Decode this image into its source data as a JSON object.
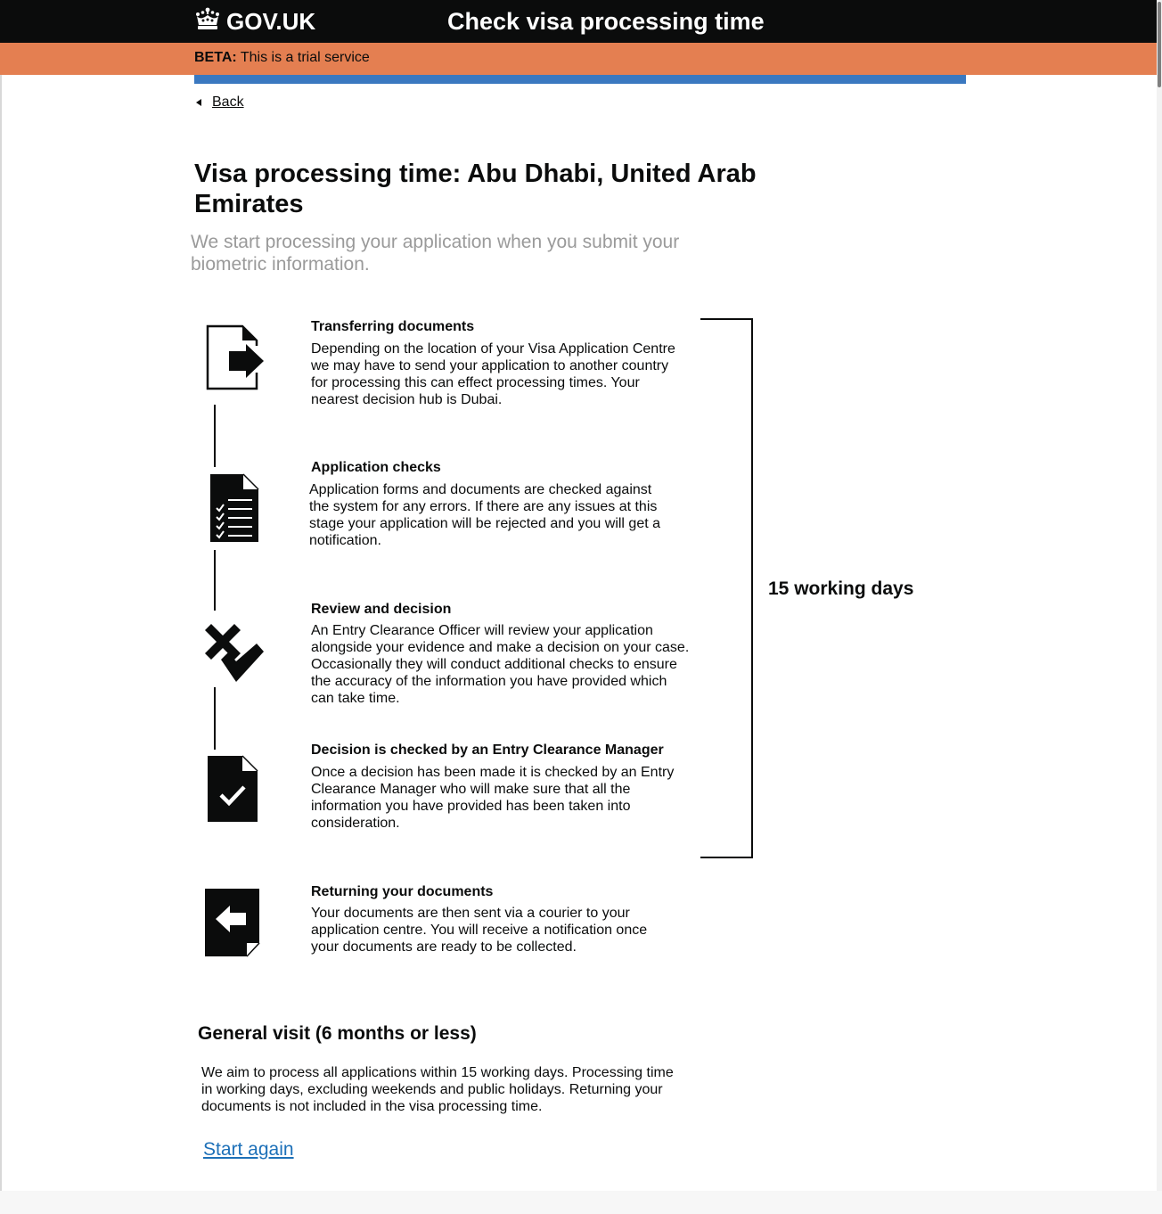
{
  "header": {
    "logo_text": "GOV.UK",
    "service_name": "Check visa processing time",
    "logo_icon": "crown-icon",
    "background": "#0b0c0c"
  },
  "beta": {
    "tag": "BETA:",
    "text": "This is a trial service",
    "color": "#e47f51"
  },
  "accent_color": "#3a78c0",
  "back_link": "Back",
  "page_title": "Visa processing time: Abu Dhabi, United Arab Emirates",
  "lede": "We start processing your application when you submit your biometric information.",
  "steps": [
    {
      "title": "Transferring documents",
      "description": "Depending on the location of your Visa Application Centre we may have to send your application to another country for processing this can effect processing times. Your nearest decision hub is Dubai.",
      "icon": "document-forward-icon"
    },
    {
      "title": "Application checks",
      "description": "Application forms and documents are checked against the system for any errors. If there are any issues at this stage your application will be rejected and you will get a notification.",
      "icon": "checklist-document-icon"
    },
    {
      "title": "Review and decision",
      "description": "An Entry Clearance Officer will review your application alongside your evidence and make a decision on your case. Occasionally they will conduct additional checks to ensure the accuracy of the information you have provided which can take time.",
      "icon": "cross-and-tick-icon"
    },
    {
      "title": "Decision is checked by an Entry Clearance Manager",
      "description": "Once a decision has been made it is checked by an Entry Clearance Manager who will make sure that all the information you have provided has been taken into consideration.",
      "icon": "approved-document-icon"
    },
    {
      "title": "Returning your documents",
      "description": "Your documents are then sent via a courier to your application centre. You will receive a notification once your documents are ready to be collected.",
      "icon": "document-return-icon"
    }
  ],
  "processing_label": "15 working days",
  "visit": {
    "heading": "General visit (6 months or less)",
    "text": "We aim to process all applications within  15 working days. Processing time in working days, excluding weekends and public holidays. Returning your documents is not included in the visa processing time."
  },
  "start_again": "Start again",
  "link_color": "#1d70b8"
}
